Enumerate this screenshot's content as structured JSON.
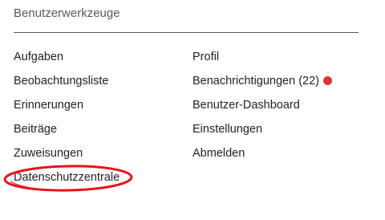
{
  "section": {
    "title": "Benutzerwerkzeuge"
  },
  "left_items": [
    {
      "label": "Aufgaben"
    },
    {
      "label": "Beobachtungsliste"
    },
    {
      "label": "Erinnerungen"
    },
    {
      "label": "Beiträge"
    },
    {
      "label": "Zuweisungen"
    },
    {
      "label": "Datenschutzzentrale"
    }
  ],
  "right_items": [
    {
      "label": "Profil"
    },
    {
      "label": "Benachrichtigungen (22)",
      "badge": "notification-dot"
    },
    {
      "label": "Benutzer-Dashboard"
    },
    {
      "label": "Einstellungen"
    },
    {
      "label": "Abmelden"
    }
  ],
  "colors": {
    "notification_dot": "#dd3333",
    "highlight_ellipse": "#e8121b",
    "heading": "#54595d"
  }
}
